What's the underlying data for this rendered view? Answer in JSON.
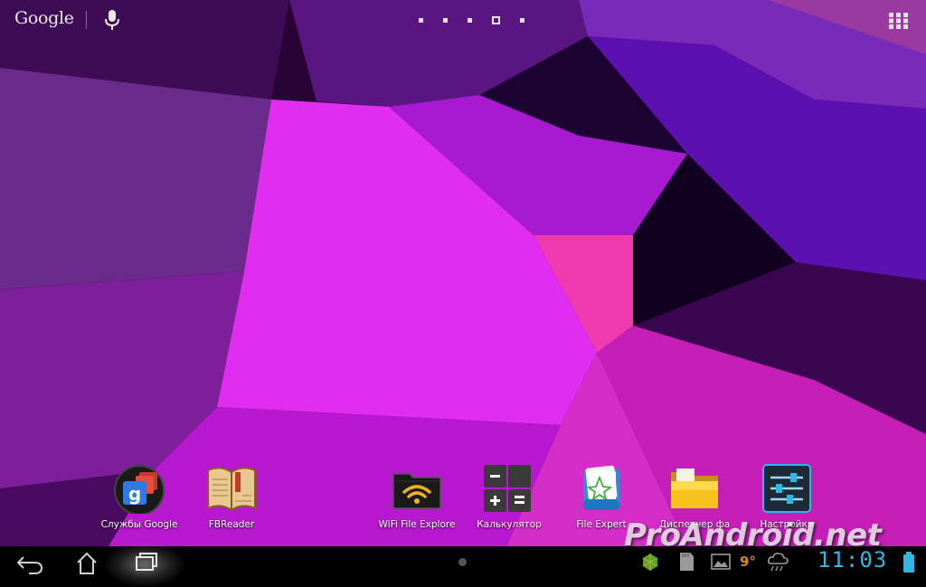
{
  "topbar": {
    "search_logo": "Google",
    "page_indicator": {
      "count": 5,
      "current": 4
    }
  },
  "dock": {
    "apps": [
      {
        "label": "Службы Google",
        "icon": "google-services-icon"
      },
      {
        "label": "FBReader",
        "icon": "book-icon"
      },
      {
        "label": "WiFi File Explore",
        "icon": "wifi-folder-icon"
      },
      {
        "label": "Калькулятор",
        "icon": "calculator-icon"
      },
      {
        "label": "File Expert",
        "icon": "file-expert-icon"
      },
      {
        "label": "Диспетчер фа",
        "icon": "folder-icon"
      },
      {
        "label": "Настройки",
        "icon": "settings-icon"
      }
    ]
  },
  "statusbar": {
    "weather_temp": "9°",
    "clock": "11:03",
    "accent_color": "#33b5e5"
  },
  "watermark": "ProAndroid.net",
  "colors": {
    "wallpaper_primary": "#d21ae8",
    "wallpaper_secondary": "#6a1bd6"
  }
}
